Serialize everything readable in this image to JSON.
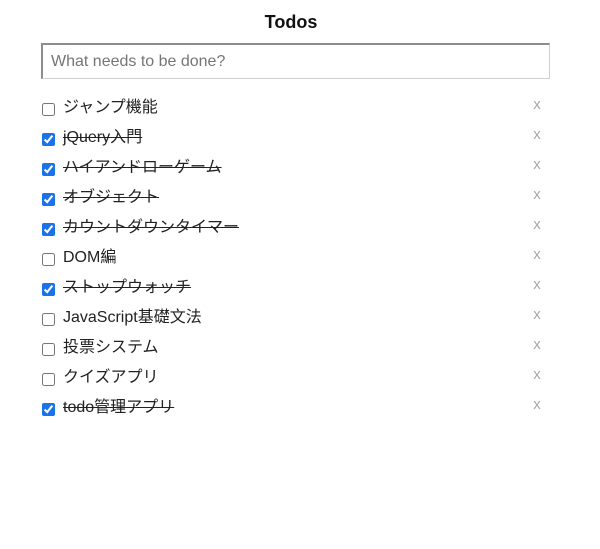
{
  "header": {
    "title": "Todos"
  },
  "new_todo": {
    "placeholder": "What needs to be done?",
    "value": ""
  },
  "delete_label": "x",
  "todos": [
    {
      "text": "ジャンプ機能",
      "done": false
    },
    {
      "text": "jQuery入門",
      "done": true
    },
    {
      "text": "ハイアンドローゲーム",
      "done": true
    },
    {
      "text": "オブジェクト",
      "done": true
    },
    {
      "text": "カウントダウンタイマー",
      "done": true
    },
    {
      "text": "DOM編",
      "done": false
    },
    {
      "text": "ストップウォッチ",
      "done": true
    },
    {
      "text": "JavaScript基礎文法",
      "done": false
    },
    {
      "text": "投票システム",
      "done": false
    },
    {
      "text": "クイズアプリ",
      "done": false
    },
    {
      "text": "todo管理アプリ",
      "done": true
    }
  ]
}
